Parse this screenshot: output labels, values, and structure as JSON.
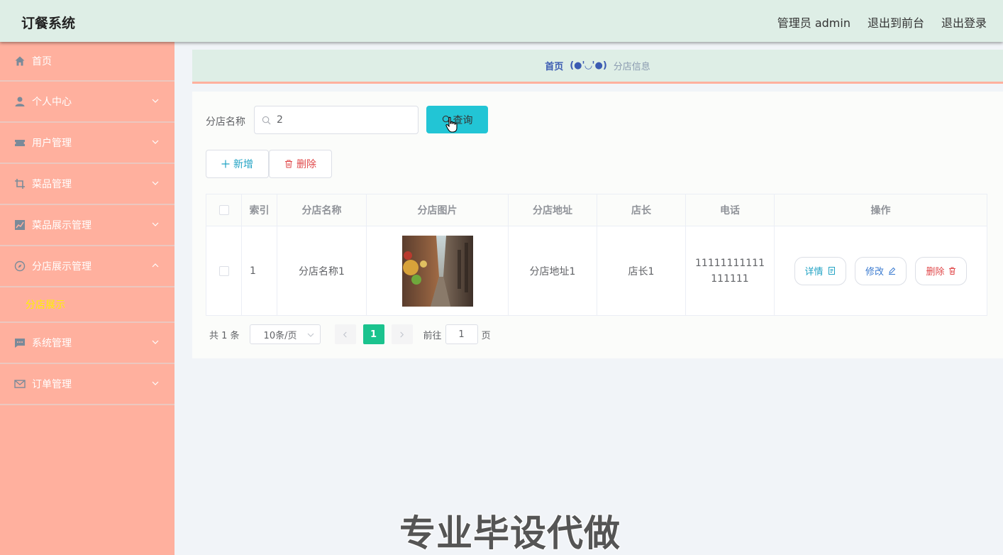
{
  "app": {
    "title": "订餐系统"
  },
  "header": {
    "links": [
      "管理员 admin",
      "退出到前台",
      "退出登录"
    ]
  },
  "sidebar": {
    "items": [
      {
        "label": "首页",
        "icon": "home-icon"
      },
      {
        "label": "个人中心",
        "icon": "user-icon"
      },
      {
        "label": "用户管理",
        "icon": "ticket-icon"
      },
      {
        "label": "菜品管理",
        "icon": "crop-icon"
      },
      {
        "label": "菜品展示管理",
        "icon": "chart-icon"
      },
      {
        "label": "分店展示管理",
        "icon": "compass-icon",
        "expanded": true,
        "children": [
          "分店展示"
        ]
      },
      {
        "label": "系统管理",
        "icon": "message-icon"
      },
      {
        "label": "订单管理",
        "icon": "mail-icon"
      }
    ]
  },
  "breadcrumb": {
    "home": "首页",
    "separator": "(●'◡'●)",
    "current": "分店信息"
  },
  "search": {
    "label": "分店名称",
    "value": "2",
    "button": "查询"
  },
  "actions": {
    "add": "新增",
    "delete": "删除"
  },
  "table": {
    "headers": [
      "索引",
      "分店名称",
      "分店图片",
      "分店地址",
      "店长",
      "电话",
      "操作"
    ],
    "rows": [
      {
        "index": "1",
        "name": "分店名称1",
        "address": "分店地址1",
        "manager": "店长1",
        "phone": "11111111111111111"
      }
    ],
    "row_actions": {
      "detail": "详情",
      "edit": "修改",
      "delete": "删除"
    }
  },
  "pagination": {
    "total": "共 1 条",
    "page_size": "10条/页",
    "current_page": "1",
    "goto_label": "前往",
    "goto_value": "1",
    "page_unit": "页"
  },
  "watermark": "专业毕设代做",
  "colors": {
    "sidebar": "#ffb09e",
    "header": "#deeee6",
    "accent": "#22c5d5",
    "active_page": "#1bc38e",
    "submenu_active": "#fff100"
  }
}
